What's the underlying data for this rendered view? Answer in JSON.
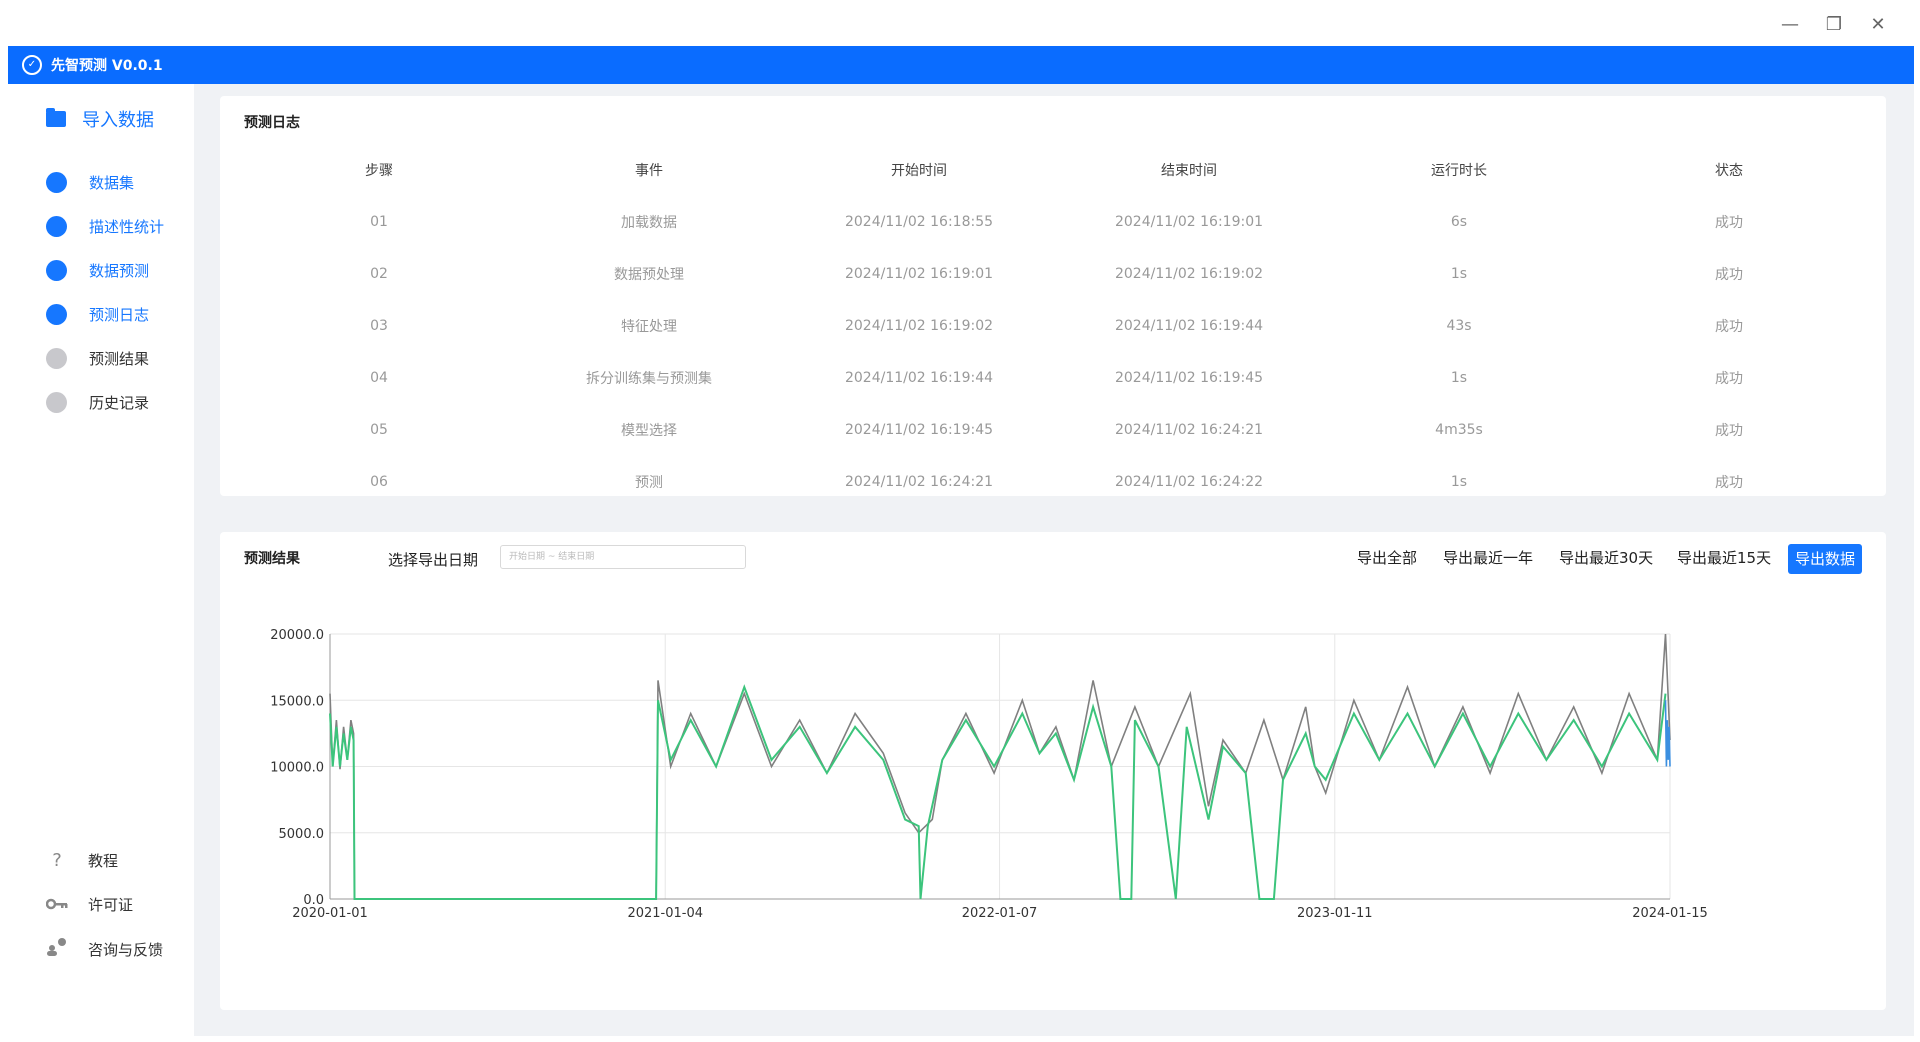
{
  "app": {
    "title": "先智预测 V0.0.1"
  },
  "window": {
    "minimize": "—",
    "restore": "❐",
    "close": "✕"
  },
  "sidebar": {
    "import_label": "导入数据",
    "items": [
      {
        "label": "数据集",
        "active": true
      },
      {
        "label": "描述性统计",
        "active": true
      },
      {
        "label": "数据预测",
        "active": true
      },
      {
        "label": "预测日志",
        "active": true
      },
      {
        "label": "预测结果",
        "active": false
      },
      {
        "label": "历史记录",
        "active": false
      }
    ],
    "bottom": [
      {
        "label": "教程",
        "icon": "question-icon"
      },
      {
        "label": "许可证",
        "icon": "key-icon"
      },
      {
        "label": "咨询与反馈",
        "icon": "feedback-icon"
      }
    ]
  },
  "log": {
    "title": "预测日志",
    "columns": [
      "步骤",
      "事件",
      "开始时间",
      "结束时间",
      "运行时长",
      "状态"
    ],
    "rows": [
      [
        "01",
        "加载数据",
        "2024/11/02 16:18:55",
        "2024/11/02 16:19:01",
        "6s",
        "成功"
      ],
      [
        "02",
        "数据预处理",
        "2024/11/02 16:19:01",
        "2024/11/02 16:19:02",
        "1s",
        "成功"
      ],
      [
        "03",
        "特征处理",
        "2024/11/02 16:19:02",
        "2024/11/02 16:19:44",
        "43s",
        "成功"
      ],
      [
        "04",
        "拆分训练集与预测集",
        "2024/11/02 16:19:44",
        "2024/11/02 16:19:45",
        "1s",
        "成功"
      ],
      [
        "05",
        "模型选择",
        "2024/11/02 16:19:45",
        "2024/11/02 16:24:21",
        "4m35s",
        "成功"
      ],
      [
        "06",
        "预测",
        "2024/11/02 16:24:21",
        "2024/11/02 16:24:22",
        "1s",
        "成功"
      ]
    ]
  },
  "result": {
    "title": "预测结果",
    "date_label": "选择导出日期",
    "date_placeholder": "开始日期 ~ 结束日期",
    "export_all": "导出全部",
    "export_year": "导出最近一年",
    "export_30": "导出最近30天",
    "export_15": "导出最近15天",
    "export_data": "导出数据"
  },
  "chart_data": {
    "type": "line",
    "x_ticks": [
      "2020-01-01",
      "2021-01-04",
      "2022-01-07",
      "2023-01-11",
      "2024-01-15"
    ],
    "y_ticks": [
      "0.0",
      "5000.0",
      "10000.0",
      "15000.0",
      "20000.0"
    ],
    "ylim": [
      0,
      20000
    ],
    "grid": true,
    "colors": {
      "actual": "#808080",
      "fitted": "#3cc47c",
      "forecast": "#3b8fe0"
    },
    "series": [
      {
        "points": [
          [
            "2020-01-01",
            15500
          ],
          [
            "2020-01-04",
            10000
          ],
          [
            "2020-01-08",
            13500
          ],
          [
            "2020-01-12",
            9800
          ],
          [
            "2020-01-16",
            13000
          ],
          [
            "2020-01-20",
            10500
          ],
          [
            "2020-01-24",
            13500
          ],
          [
            "2020-01-27",
            12500
          ],
          [
            "2020-01-28",
            0
          ],
          [
            "2020-12-25",
            0
          ],
          [
            "2020-12-27",
            16500
          ],
          [
            "2021-01-10",
            10000
          ],
          [
            "2021-02-01",
            14000
          ],
          [
            "2021-03-01",
            10000
          ],
          [
            "2021-04-01",
            15500
          ],
          [
            "2021-05-01",
            10000
          ],
          [
            "2021-06-01",
            13500
          ],
          [
            "2021-07-01",
            9500
          ],
          [
            "2021-08-01",
            14000
          ],
          [
            "2021-09-01",
            11000
          ],
          [
            "2021-09-25",
            6500
          ],
          [
            "2021-10-10",
            5000
          ],
          [
            "2021-10-25",
            6000
          ],
          [
            "2021-11-05",
            10500
          ],
          [
            "2021-12-01",
            14000
          ],
          [
            "2022-01-01",
            9500
          ],
          [
            "2022-02-01",
            15000
          ],
          [
            "2022-02-20",
            11000
          ],
          [
            "2022-03-10",
            13000
          ],
          [
            "2022-03-30",
            9000
          ],
          [
            "2022-04-20",
            16500
          ],
          [
            "2022-05-10",
            10000
          ],
          [
            "2022-06-05",
            14500
          ],
          [
            "2022-07-01",
            10000
          ],
          [
            "2022-08-05",
            15500
          ],
          [
            "2022-08-25",
            7000
          ],
          [
            "2022-09-10",
            12000
          ],
          [
            "2022-10-05",
            9500
          ],
          [
            "2022-10-25",
            13500
          ],
          [
            "2022-11-15",
            9000
          ],
          [
            "2022-12-10",
            14500
          ],
          [
            "2022-12-20",
            10000
          ],
          [
            "2023-01-01",
            8000
          ],
          [
            "2023-02-01",
            15000
          ],
          [
            "2023-03-01",
            10500
          ],
          [
            "2023-04-01",
            16000
          ],
          [
            "2023-05-01",
            10000
          ],
          [
            "2023-06-01",
            14500
          ],
          [
            "2023-07-01",
            9500
          ],
          [
            "2023-08-01",
            15500
          ],
          [
            "2023-09-01",
            10500
          ],
          [
            "2023-10-01",
            14500
          ],
          [
            "2023-11-01",
            9500
          ],
          [
            "2023-12-01",
            15500
          ],
          [
            "2024-01-01",
            10500
          ],
          [
            "2024-01-10",
            20000
          ],
          [
            "2024-01-15",
            12000
          ]
        ]
      },
      {
        "points": [
          [
            "2020-01-01",
            14000
          ],
          [
            "2020-01-04",
            10000
          ],
          [
            "2020-01-08",
            13000
          ],
          [
            "2020-01-12",
            10000
          ],
          [
            "2020-01-16",
            12500
          ],
          [
            "2020-01-20",
            10500
          ],
          [
            "2020-01-24",
            13000
          ],
          [
            "2020-01-27",
            12000
          ],
          [
            "2020-01-28",
            0
          ],
          [
            "2020-12-25",
            0
          ],
          [
            "2020-12-27",
            15000
          ],
          [
            "2021-01-10",
            10500
          ],
          [
            "2021-02-01",
            13500
          ],
          [
            "2021-03-01",
            10000
          ],
          [
            "2021-04-01",
            16000
          ],
          [
            "2021-05-01",
            10500
          ],
          [
            "2021-06-01",
            13000
          ],
          [
            "2021-07-01",
            9500
          ],
          [
            "2021-08-01",
            13000
          ],
          [
            "2021-09-01",
            10500
          ],
          [
            "2021-09-25",
            6000
          ],
          [
            "2021-10-10",
            5500
          ],
          [
            "2021-10-12",
            0
          ],
          [
            "2021-10-20",
            5500
          ],
          [
            "2021-11-05",
            10500
          ],
          [
            "2021-12-01",
            13500
          ],
          [
            "2022-01-01",
            10000
          ],
          [
            "2022-02-01",
            14000
          ],
          [
            "2022-02-20",
            11000
          ],
          [
            "2022-03-10",
            12500
          ],
          [
            "2022-03-30",
            9000
          ],
          [
            "2022-04-20",
            14500
          ],
          [
            "2022-05-10",
            10000
          ],
          [
            "2022-05-20",
            0
          ],
          [
            "2022-06-01",
            0
          ],
          [
            "2022-06-05",
            13500
          ],
          [
            "2022-07-01",
            10000
          ],
          [
            "2022-07-20",
            0
          ],
          [
            "2022-08-01",
            13000
          ],
          [
            "2022-08-25",
            6000
          ],
          [
            "2022-09-10",
            11500
          ],
          [
            "2022-10-05",
            9500
          ],
          [
            "2022-10-20",
            0
          ],
          [
            "2022-11-05",
            0
          ],
          [
            "2022-11-15",
            9000
          ],
          [
            "2022-12-10",
            12500
          ],
          [
            "2022-12-20",
            10000
          ],
          [
            "2023-01-01",
            9000
          ],
          [
            "2023-02-01",
            14000
          ],
          [
            "2023-03-01",
            10500
          ],
          [
            "2023-04-01",
            14000
          ],
          [
            "2023-05-01",
            10000
          ],
          [
            "2023-06-01",
            14000
          ],
          [
            "2023-07-01",
            10000
          ],
          [
            "2023-08-01",
            14000
          ],
          [
            "2023-09-01",
            10500
          ],
          [
            "2023-10-01",
            13500
          ],
          [
            "2023-11-01",
            10000
          ],
          [
            "2023-12-01",
            14000
          ],
          [
            "2024-01-01",
            10500
          ],
          [
            "2024-01-10",
            15500
          ]
        ]
      },
      {
        "points": [
          [
            "2024-01-10",
            15000
          ],
          [
            "2024-01-11",
            10000
          ],
          [
            "2024-01-12",
            13500
          ],
          [
            "2024-01-13",
            10500
          ],
          [
            "2024-01-14",
            13000
          ],
          [
            "2024-01-15",
            10000
          ]
        ]
      }
    ]
  }
}
